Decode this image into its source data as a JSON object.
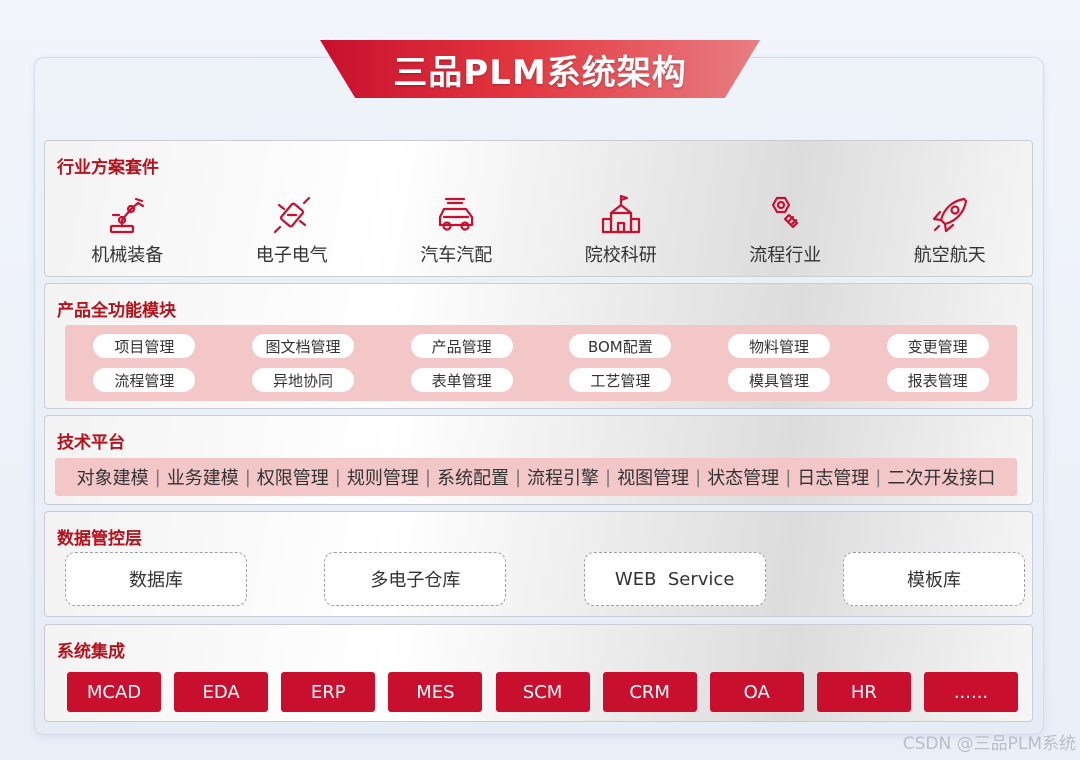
{
  "title": "三品PLM系统架构",
  "sections": {
    "industry": {
      "title": "行业方案套件",
      "items": [
        {
          "label": "机械装备",
          "icon": "robot-arm-icon"
        },
        {
          "label": "电子电气",
          "icon": "electronics-icon"
        },
        {
          "label": "汽车汽配",
          "icon": "car-icon"
        },
        {
          "label": "院校科研",
          "icon": "school-icon"
        },
        {
          "label": "流程行业",
          "icon": "bolt-nut-icon"
        },
        {
          "label": "航空航天",
          "icon": "rocket-icon"
        }
      ]
    },
    "modules": {
      "title": "产品全功能模块",
      "row1": [
        "项目管理",
        "图文档管理",
        "产品管理",
        "BOM配置",
        "物料管理",
        "变更管理"
      ],
      "row2": [
        "流程管理",
        "异地协同",
        "表单管理",
        "工艺管理",
        "模具管理",
        "报表管理"
      ]
    },
    "tech": {
      "title": "技术平台",
      "items": [
        "对象建模",
        "业务建模",
        "权限管理",
        "规则管理",
        "系统配置",
        "流程引擎",
        "视图管理",
        "状态管理",
        "日志管理",
        "二次开发接口"
      ]
    },
    "data": {
      "title": "数据管控层",
      "items": [
        "数据库",
        "多电子仓库",
        "WEB  Service",
        "模板库"
      ]
    },
    "integration": {
      "title": "系统集成",
      "items": [
        "MCAD",
        "EDA",
        "ERP",
        "MES",
        "SCM",
        "CRM",
        "OA",
        "HR",
        "......"
      ]
    }
  },
  "watermark": "CSDN @三品PLM系统",
  "colors": {
    "accent": "#c8102e",
    "pink": "#f3c6c7",
    "section_title": "#b5121b"
  }
}
